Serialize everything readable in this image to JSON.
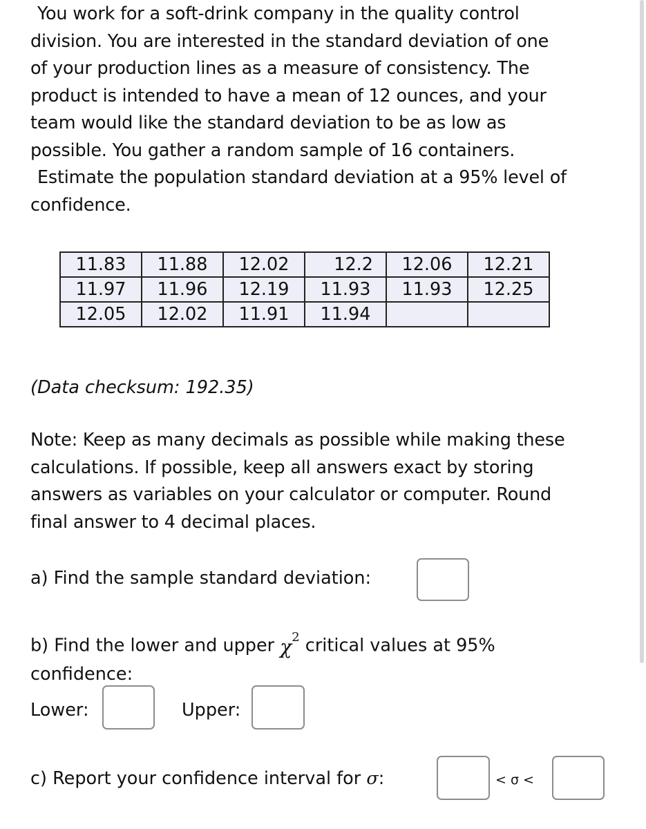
{
  "problem": {
    "intro_lines": [
      "You work for a soft-drink company in the quality control",
      "division.  You are interested in the standard deviation of one",
      "of your production lines as a measure of consistency. The",
      "product is intended to have a mean of 12 ounces, and your",
      "team would like the standard deviation to be as low as",
      "possible.  You gather a random sample of 16 containers.",
      "Estimate the population standard deviation at a 95% level of",
      "confidence."
    ],
    "data_table": {
      "rows": [
        [
          "11.83",
          "11.88",
          "12.02",
          "12.2",
          "12.06",
          "12.21"
        ],
        [
          "11.97",
          "11.96",
          "12.19",
          "11.93",
          "11.93",
          "12.25"
        ],
        [
          "12.05",
          "12.02",
          "11.91",
          "11.94",
          "",
          ""
        ]
      ]
    },
    "checksum": "(Data checksum: 192.35)",
    "note_lines": [
      "Note: Keep as many decimals as  possible while making these",
      "calculations. If possible, keep all answers exact by storing",
      "answers as variables on your calculator or computer.   Round",
      "final answer to 4 decimal places."
    ]
  },
  "questions": {
    "a": {
      "label": "a) Find the sample standard deviation:",
      "answer_value": ""
    },
    "b": {
      "label_before": "b) Find the lower and upper",
      "symbol": "χ",
      "symbol_sup": "2",
      "label_after": "critical values at 95%",
      "label_line2": "confidence:",
      "lower_label": "Lower:",
      "upper_label": "Upper:",
      "lower_value": "",
      "upper_value": ""
    },
    "c": {
      "label": "c) Report your confidence interval for",
      "symbol": "σ",
      "colon": ":",
      "inequality": "< σ <",
      "lower_value": "",
      "upper_value": ""
    }
  }
}
